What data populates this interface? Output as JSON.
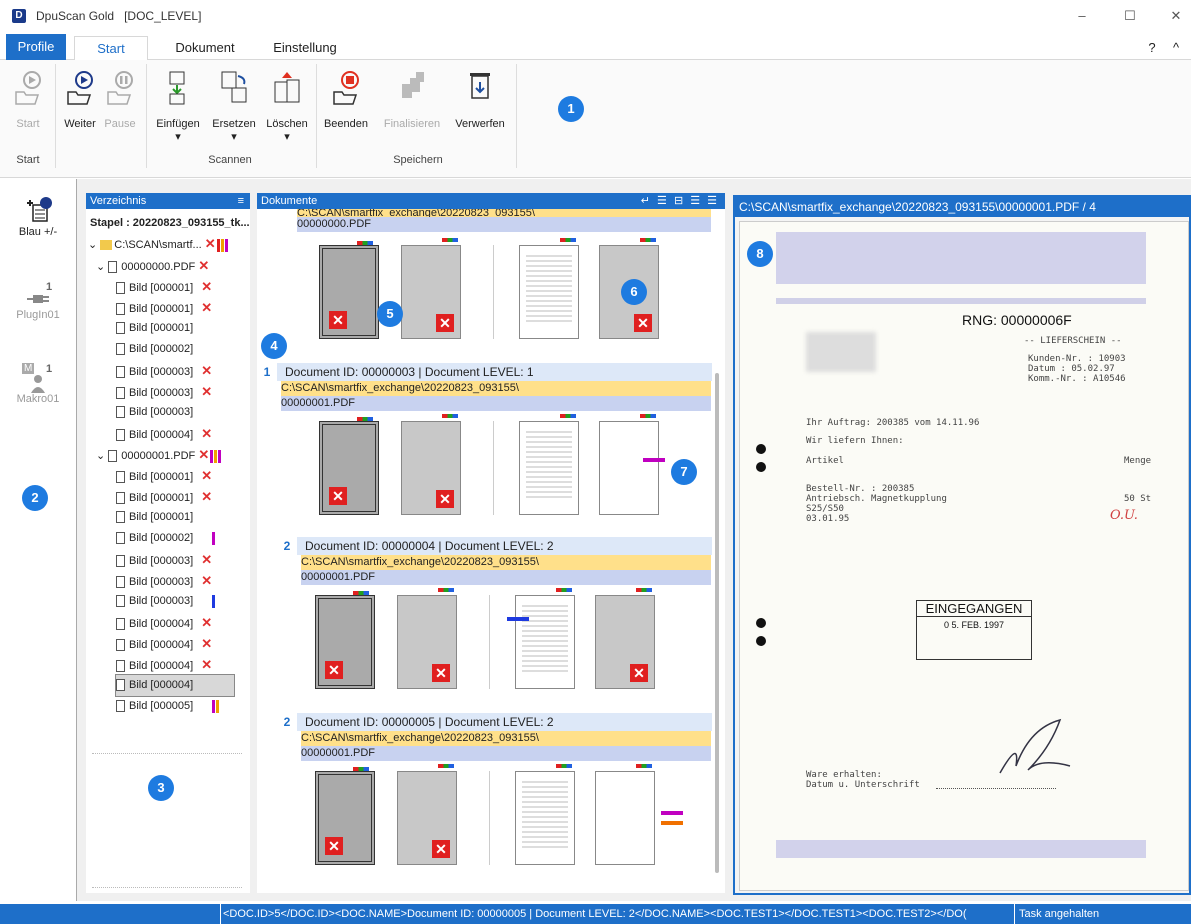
{
  "app": {
    "logo": "D",
    "title": "DpuScan Gold",
    "doc_level": "[DOC_LEVEL]",
    "minimize": "–",
    "maximize": "☐",
    "close": "✕",
    "help": "?",
    "collapse": "^"
  },
  "tabs": {
    "profile": "Profile",
    "start": "Start",
    "dokument": "Dokument",
    "einstellung": "Einstellung"
  },
  "ribbon": {
    "start": "Start",
    "weiter": "Weiter",
    "pause": "Pause",
    "einfuegen": "Einfügen",
    "ersetzen": "Ersetzen",
    "loeschen": "Löschen",
    "beenden": "Beenden",
    "finalisieren": "Finalisieren",
    "verwerfen": "Verwerfen",
    "group_start": "Start",
    "group_scannen": "Scannen",
    "group_speichern": "Speichern",
    "dropdown": "▾"
  },
  "callouts": [
    "1",
    "2",
    "3",
    "4",
    "5",
    "6",
    "7",
    "8"
  ],
  "leftstrip": {
    "blau": "Blau +/-",
    "plugin_count": "1",
    "plugin": "PlugIn01",
    "makro_badge": "M",
    "makro_count": "1",
    "makro": "Makro01"
  },
  "tree": {
    "title": "Verzeichnis",
    "menu": "≡",
    "stapel": "Stapel : 20220823_093155_tk...",
    "root": "C:\\SCAN\\smartf...",
    "file0": "00000000.PDF",
    "file1": "00000001.PDF",
    "items0": [
      "Bild [000001]",
      "Bild [000001]",
      "Bild [000001]",
      "Bild [000002]",
      "Bild [000003]",
      "Bild [000003]",
      "Bild [000003]",
      "Bild [000004]"
    ],
    "items1": [
      "Bild [000001]",
      "Bild [000001]",
      "Bild [000001]",
      "Bild [000002]",
      "Bild [000003]",
      "Bild [000003]",
      "Bild [000003]",
      "Bild [000004]",
      "Bild [000004]",
      "Bild [000004]",
      "Bild [000004]",
      "Bild [000005]"
    ],
    "x": "✕"
  },
  "docs": {
    "title": "Dokumente",
    "tool_icons": "↵ ☰ ⊟ ☰ ☰",
    "first_path1": "C:\\SCAN\\smartfix_exchange\\20220823_093155\\",
    "first_path2": "00000000.PDF",
    "groups": [
      {
        "num": "1",
        "head": "Document ID: 00000003 | Document LEVEL: 1",
        "path1": "C:\\SCAN\\smartfix_exchange\\20220823_093155\\",
        "path2": "00000001.PDF"
      },
      {
        "num": "2",
        "head": "Document ID: 00000004 | Document LEVEL: 2",
        "path1": "C:\\SCAN\\smartfix_exchange\\20220823_093155\\",
        "path2": "00000001.PDF"
      },
      {
        "num": "2",
        "head": "Document ID: 00000005 | Document LEVEL: 2",
        "path1": "C:\\SCAN\\smartfix_exchange\\20220823_093155\\",
        "path2": "00000001.PDF"
      }
    ],
    "x": "✕"
  },
  "preview": {
    "title": "C:\\SCAN\\smartfix_exchange\\20220823_093155\\00000001.PDF / 4",
    "rng": "RNG: 00000006F",
    "header_line": "-- LIEFERSCHEIN --",
    "kunden": "Kunden-Nr. : 10903",
    "datum": "Datum      : 05.02.97",
    "komm": "Komm.-Nr.  : A10546",
    "auftrag": "Ihr Auftrag: 200385   vom 14.11.96",
    "liefern": "Wir liefern Ihnen:",
    "artikel": "Artikel",
    "menge": "Menge",
    "bestell": "Bestell-Nr. : 200385",
    "antrieb": "Antriebsch. Magnetkupplung",
    "s25": "S25/S50",
    "d03": "03.01.95",
    "st": "50  St",
    "ou": "O.U.",
    "stamp1": "EINGEGANGEN",
    "stamp2": "0 5. FEB. 1997",
    "ware": "Ware erhalten:",
    "datum_unt": "Datum u. Unterschrift"
  },
  "status": {
    "text": "<DOC.ID>5</DOC.ID><DOC.NAME>Document ID: 00000005 | Document LEVEL: 2</DOC.NAME><DOC.TEST1></DOC.TEST1><DOC.TEST2></DO(",
    "task": "Task angehalten"
  },
  "colors": {
    "accent": "#1e6fc9",
    "callout": "#1e7be0",
    "error": "#e02020",
    "path_yellow": "#ffe08a",
    "path_blue": "#c8d2f0"
  }
}
